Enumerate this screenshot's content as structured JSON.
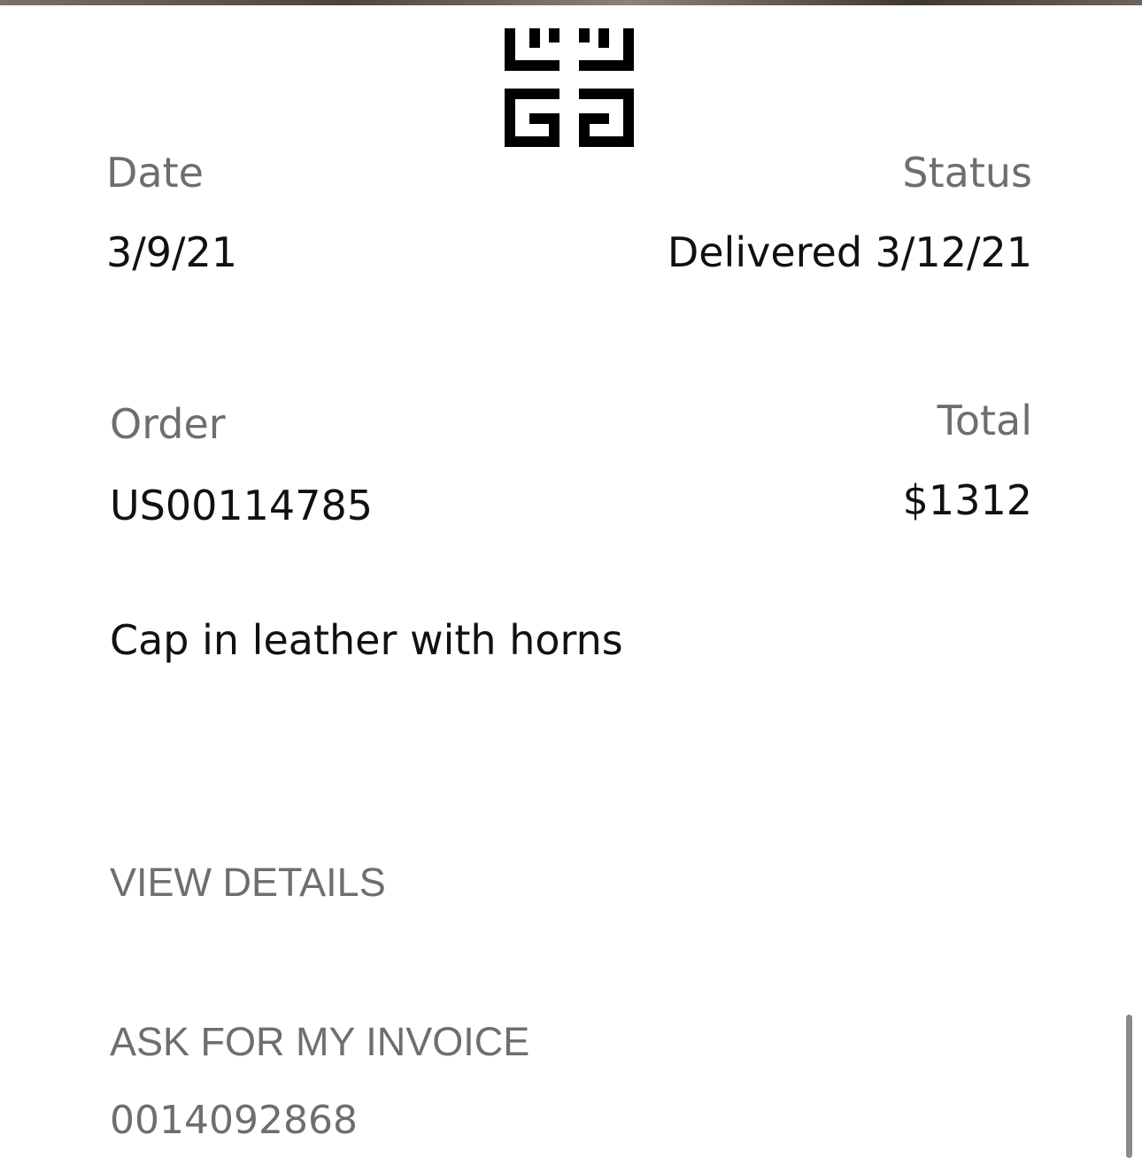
{
  "header": {
    "logo_icon": "givenchy-4g-logo-icon"
  },
  "order": {
    "date_label": "Date",
    "date_value": "3/9/21",
    "status_label": "Status",
    "status_value": "Delivered 3/12/21",
    "order_label": "Order",
    "order_value": "US00114785",
    "total_label": "Total",
    "total_value": "$1312",
    "product_name": "Cap in leather with horns"
  },
  "actions": {
    "view_details": "VIEW DETAILS",
    "ask_invoice": "ASK FOR MY INVOICE",
    "invoice_number": "0014092868"
  },
  "colors": {
    "label_gray": "#6e6e6e",
    "text_black": "#111111",
    "background": "#ffffff"
  }
}
